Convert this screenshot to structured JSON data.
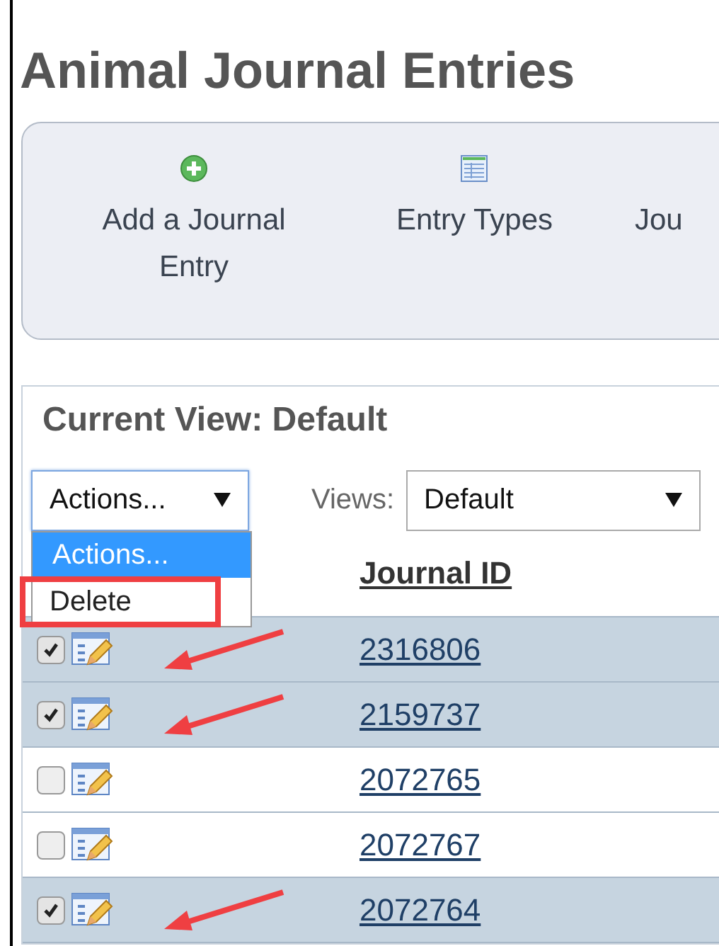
{
  "page_title": "Animal Journal Entries",
  "toolbar": [
    {
      "label": "Add a Journal Entry",
      "kind": "add"
    },
    {
      "label": "Entry Types",
      "kind": "table"
    },
    {
      "label": "Jou",
      "kind": "none"
    }
  ],
  "view_heading": "Current View: Default",
  "actions_select": {
    "value": "Actions...",
    "expanded": true,
    "options": [
      {
        "label": "Actions...",
        "selected": true,
        "annotated": false
      },
      {
        "label": "Delete",
        "selected": false,
        "annotated": true
      }
    ]
  },
  "views": {
    "label": "Views:",
    "value": "Default"
  },
  "table": {
    "columns": [
      "Journal ID"
    ],
    "rows": [
      {
        "checked": true,
        "arrow": true,
        "journal_id": "2316806"
      },
      {
        "checked": true,
        "arrow": true,
        "journal_id": "2159737"
      },
      {
        "checked": false,
        "arrow": false,
        "journal_id": "2072765"
      },
      {
        "checked": false,
        "arrow": false,
        "journal_id": "2072767"
      },
      {
        "checked": true,
        "arrow": true,
        "journal_id": "2072764"
      }
    ]
  }
}
